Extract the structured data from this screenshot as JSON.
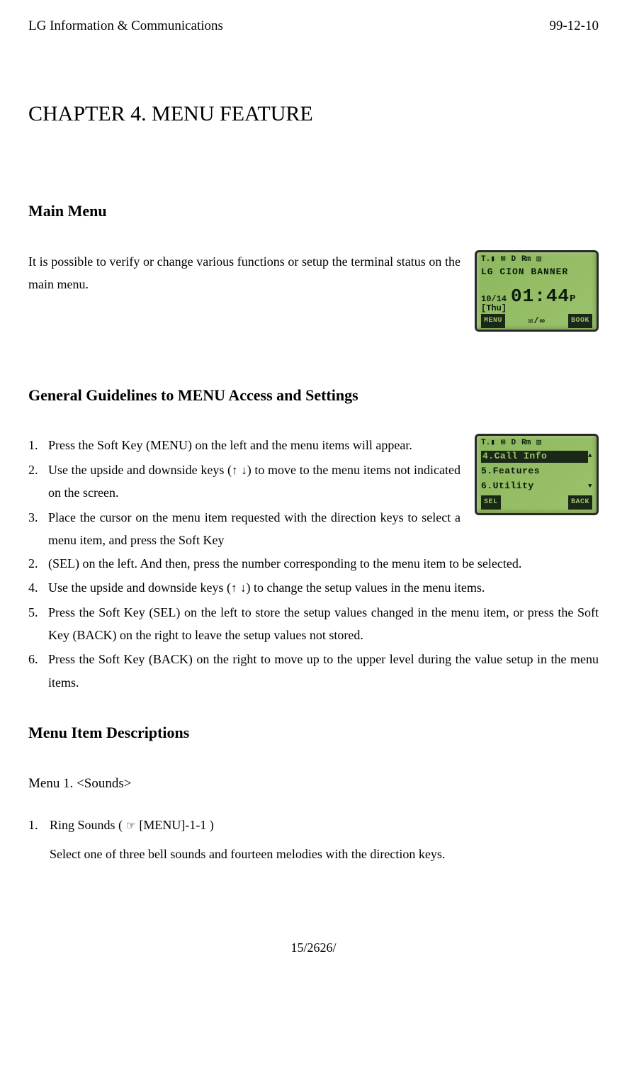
{
  "header": {
    "left": "LG Information & Communications",
    "right": "99-12-10"
  },
  "chapter_title": "CHAPTER 4. MENU FEATURE",
  "section_main": {
    "heading": "Main Menu",
    "intro": "It is possible to verify or change various functions or setup the terminal status on the main menu."
  },
  "lcd1": {
    "banner": "LG CION BANNER",
    "date": "10/14",
    "day": "[Thu]",
    "time": "01:44",
    "ampm": "P",
    "soft_left": "MENU",
    "soft_mid": "✉/∞",
    "soft_right": "BOOK",
    "icons": {
      "signal": "▮▮▮",
      "mail": "⊠",
      "d": "D",
      "rm": "Rm",
      "batt": "▥"
    }
  },
  "section_guidelines": {
    "heading": "General Guidelines to MENU Access and Settings",
    "items_narrow": [
      "Press the Soft Key (MENU) on the left and the menu items will appear.",
      "Use the upside and downside keys (↑ ↓) to move to the menu items not indicated on the screen.",
      "Place the cursor on the menu item requested with the direction keys to select a menu item, and press the Soft Key"
    ],
    "item3_cont": "(SEL) on the left. And then, press the number corresponding to the menu item to be selected.",
    "items_full": [
      "Use the upside and downside keys (↑ ↓) to change the setup values in the menu items.",
      "Press the Soft Key (SEL) on the left to store the setup values changed in the menu item, or press the Soft Key (BACK) on the right to leave the setup values not stored.",
      "Press the Soft Key (BACK) on the right to move up to the upper level during the value setup in the menu items."
    ]
  },
  "lcd2": {
    "row1": "4.Call Info",
    "row2": "5.Features",
    "row3": "6.Utility",
    "soft_left": "SEL",
    "soft_right": "BACK",
    "icons": {
      "signal": "▮▮▮",
      "mail": "⊠",
      "d": "D",
      "rm": "Rm",
      "batt": "▥"
    }
  },
  "section_desc": {
    "heading": "Menu Item Descriptions",
    "menu1_label": "Menu 1. <Sounds>",
    "item1_title": "Ring Sounds ( ☞ [MENU]-1-1 )",
    "item1_desc": "Select one of three bell sounds and fourteen melodies with the direction keys."
  },
  "glyphs": {
    "up": "é",
    "down": "ê",
    "hand": "F"
  },
  "footer": "15/2626/"
}
